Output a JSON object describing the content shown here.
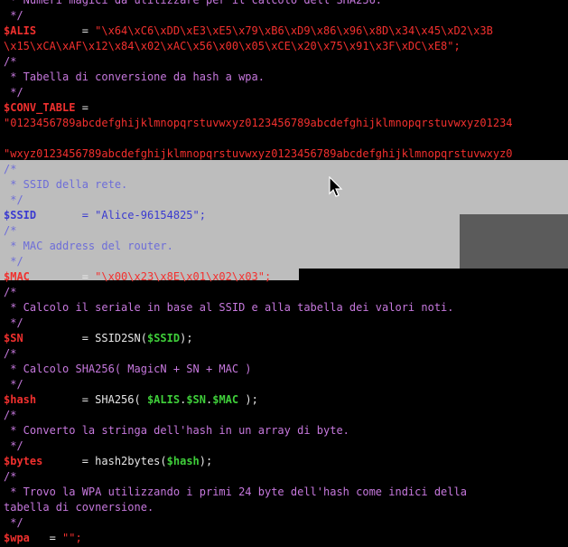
{
  "editor": {
    "lines": [
      {
        "kind": "comment",
        "text": " * Numeri magici da utilizzare per il calcolo dell'SHA256."
      },
      {
        "kind": "comment",
        "text": " */"
      },
      {
        "kind": "assign",
        "var": "$ALIS",
        "pad": "       = ",
        "value": "\"\\x64\\xC6\\xDD\\xE3\\xE5\\x79\\xB6\\xD9\\x86\\x96\\x8D\\x34\\x45\\xD2\\x3B"
      },
      {
        "kind": "plain-str",
        "text": "\\x15\\xCA\\xAF\\x12\\x84\\x02\\xAC\\x56\\x00\\x05\\xCE\\x20\\x75\\x91\\x3F\\xDC\\xE8\";"
      },
      {
        "kind": "comment",
        "text": "/*"
      },
      {
        "kind": "comment",
        "text": " * Tabella di conversione da hash a wpa."
      },
      {
        "kind": "comment",
        "text": " */"
      },
      {
        "kind": "varonly",
        "var": "$CONV_TABLE",
        "rest": " ="
      },
      {
        "kind": "plain-str",
        "text": "\"0123456789abcdefghijklmnopqrstuvwxyz0123456789abcdefghijklmnopqrstuvwxyz01234"
      },
      {
        "kind": "blank",
        "text": ""
      },
      {
        "kind": "plain-str",
        "text": "\"wxyz0123456789abcdefghijklmnopqrstuvwxyz0123456789abcdefghijklmnopqrstuvwxyz0"
      },
      {
        "kind": "comment",
        "text": "/*"
      },
      {
        "kind": "comment",
        "text": " * SSID della rete."
      },
      {
        "kind": "comment",
        "text": " */"
      },
      {
        "kind": "assign",
        "var": "$SSID",
        "pad": "       = ",
        "value": "\"Alice-96154825\";"
      },
      {
        "kind": "comment",
        "text": "/*"
      },
      {
        "kind": "comment",
        "text": " * MAC address del router."
      },
      {
        "kind": "comment",
        "text": " */"
      },
      {
        "kind": "assign",
        "var": "$MAC",
        "pad": "        = ",
        "value": "\"\\x00\\x23\\x8E\\x01\\x02\\x03\";"
      },
      {
        "kind": "comment",
        "text": "/*"
      },
      {
        "kind": "comment",
        "text": " * Calcolo il seriale in base al SSID e alla tabella dei valori noti."
      },
      {
        "kind": "comment",
        "text": " */"
      },
      {
        "kind": "call",
        "var": "$SN",
        "pad": "         = ",
        "fn": "SSID2SN(",
        "arg": "$SSID",
        "tail": ");"
      },
      {
        "kind": "comment",
        "text": "/*"
      },
      {
        "kind": "comment",
        "text": " * Calcolo SHA256( MagicN + SN + MAC )"
      },
      {
        "kind": "comment",
        "text": " */"
      },
      {
        "kind": "call3",
        "var": "$hash",
        "pad": "       = ",
        "fn": "SHA256( ",
        "a1": "$ALIS",
        "d1": ".",
        "a2": "$SN",
        "d2": ".",
        "a3": "$MAC",
        "tail": " );"
      },
      {
        "kind": "comment",
        "text": "/*"
      },
      {
        "kind": "comment",
        "text": " * Converto la stringa dell'hash in un array di byte."
      },
      {
        "kind": "comment",
        "text": " */"
      },
      {
        "kind": "call",
        "var": "$bytes",
        "pad": "      = ",
        "fn": "hash2bytes(",
        "arg": "$hash",
        "tail": ");"
      },
      {
        "kind": "comment",
        "text": "/*"
      },
      {
        "kind": "comment",
        "text": " * Trovo la WPA utilizzando i primi 24 byte dell'hash come indici della"
      },
      {
        "kind": "comment",
        "text": "tabella di covnersione."
      },
      {
        "kind": "comment",
        "text": " */"
      },
      {
        "kind": "assign",
        "var": "$wpa",
        "pad": "   = ",
        "value": "\"\";"
      }
    ]
  },
  "colors": {
    "background": "#000000",
    "comment": "#c678dd",
    "variable": "#f0302e",
    "variable_green": "#3fcf3a",
    "string": "#f3302e",
    "selection": "#bdbdbd"
  }
}
